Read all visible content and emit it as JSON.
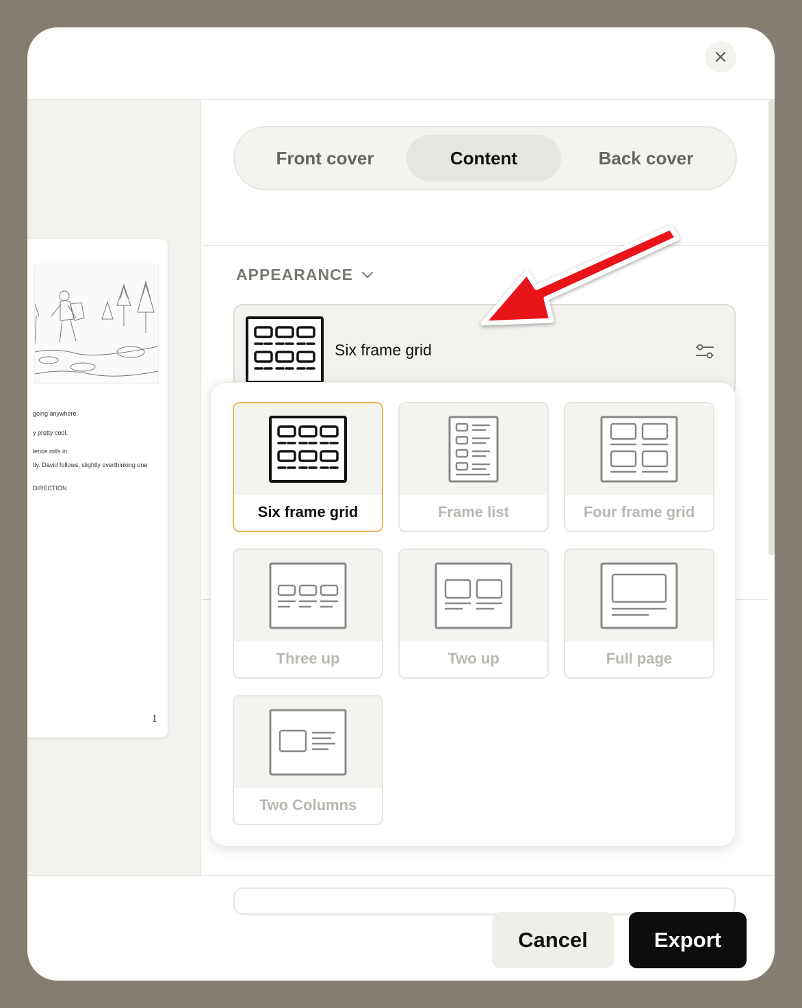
{
  "tabs": [
    {
      "label": "Front cover",
      "active": false
    },
    {
      "label": "Content",
      "active": true
    },
    {
      "label": "Back cover",
      "active": false
    }
  ],
  "appearance": {
    "heading": "APPEARANCE",
    "selected_layout": "Six frame grid"
  },
  "layouts": [
    {
      "label": "Six frame grid",
      "icon": "six-frame-grid-icon",
      "selected": true
    },
    {
      "label": "Frame list",
      "icon": "frame-list-icon",
      "selected": false
    },
    {
      "label": "Four frame grid",
      "icon": "four-frame-grid-icon",
      "selected": false
    },
    {
      "label": "Three up",
      "icon": "three-up-icon",
      "selected": false
    },
    {
      "label": "Two up",
      "icon": "two-up-icon",
      "selected": false
    },
    {
      "label": "Full page",
      "icon": "full-page-icon",
      "selected": false
    },
    {
      "label": "Two Columns",
      "icon": "two-columns-icon",
      "selected": false
    }
  ],
  "preview": {
    "lines": [
      "going anywhere.",
      "y pretty cool.",
      "lence rolls in.",
      "tly. David follows, slightly overthinking one",
      "DIRECTION"
    ],
    "page_number": "1"
  },
  "footer": {
    "cancel_label": "Cancel",
    "export_label": "Export"
  },
  "colors": {
    "backdrop": "#847d70",
    "selected_border": "#efb458",
    "annotation_arrow": "#e8141a",
    "primary_button": "#0d0d0d"
  }
}
